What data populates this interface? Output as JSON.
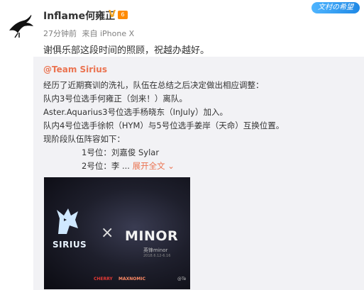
{
  "post": {
    "author": "Inflame何雍正",
    "verified_badge": "V",
    "level_badge": "6",
    "brand_tag": "文村の希望",
    "time": "27分钟前",
    "source": "来自 iPhone X",
    "text": "谢俱乐部这段时间的照顾，祝越办越好。"
  },
  "repost": {
    "user": "@Team Sirius",
    "lines": [
      "经历了近期赛训的洗礼，队伍在总结之后决定做出相应调整：",
      "队内3号位选手何雍正（剑来！）离队。",
      "Aster.Aquarius3号位选手杨晓东（InJuly）加入。",
      "队内4号位选手徐帜（HYM）与5号位选手姜岸（天命）互换位置。",
      "现阶段队伍阵容如下："
    ],
    "roster_1": "1号位：刘嘉俊 Sylar",
    "roster_2_prefix": "2号位：李 ...",
    "expand_label": "展开全文 ⌄"
  },
  "poster": {
    "team1": "SIRIUS",
    "cross": "×",
    "team2": "MINOR",
    "team2_sub": "英锋minor",
    "date": "2018.6.12-6.16",
    "sponsor1": "CHERRY",
    "sponsor2": "MAXNOMIC",
    "watermark": "@Te"
  }
}
